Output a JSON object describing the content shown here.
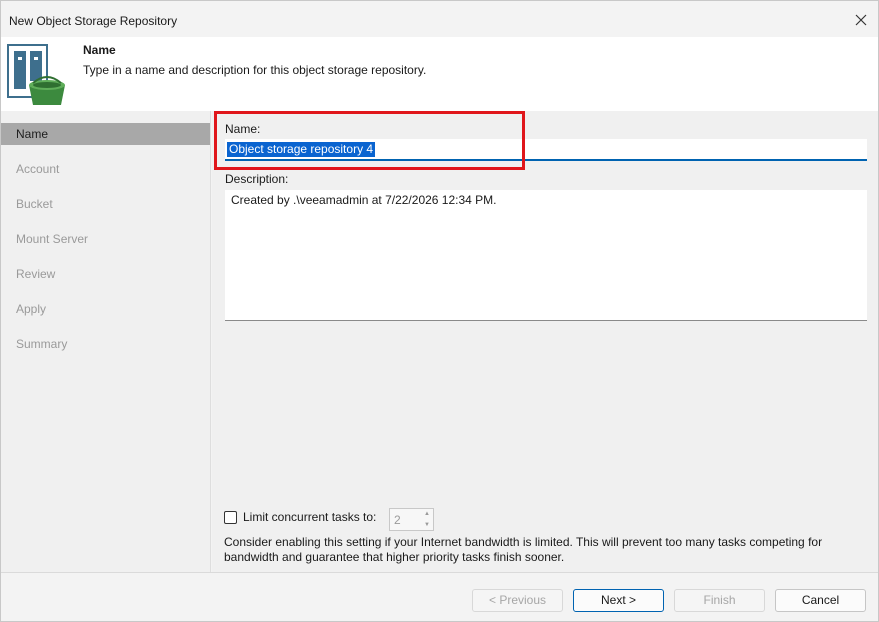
{
  "window": {
    "title": "New Object Storage Repository"
  },
  "header": {
    "title": "Name",
    "subtitle": "Type in a name and description for this object storage repository."
  },
  "steps": [
    {
      "label": "Name",
      "active": true
    },
    {
      "label": "Account",
      "active": false
    },
    {
      "label": "Bucket",
      "active": false
    },
    {
      "label": "Mount Server",
      "active": false
    },
    {
      "label": "Review",
      "active": false
    },
    {
      "label": "Apply",
      "active": false
    },
    {
      "label": "Summary",
      "active": false
    }
  ],
  "form": {
    "name_label": "Name:",
    "name_value": "Object storage repository 4",
    "description_label": "Description:",
    "description_value": "Created by .\\veeamadmin at 7/22/2026 12:34 PM.",
    "limit_label": "Limit concurrent tasks to:",
    "limit_checked": false,
    "limit_value": "2",
    "note": "Consider enabling this setting if your Internet bandwidth is limited. This will prevent too many tasks competing for bandwidth and guarantee that higher priority tasks finish sooner."
  },
  "buttons": {
    "previous": "< Previous",
    "next": "Next >",
    "finish": "Finish",
    "cancel": "Cancel"
  },
  "colors": {
    "accent": "#0063b1",
    "highlight": "#e0161b",
    "selection": "#0a64d0",
    "bucket_green": "#3c8a3e"
  },
  "icons": {
    "close": "close-icon",
    "logo": "object-storage-repository-icon"
  }
}
